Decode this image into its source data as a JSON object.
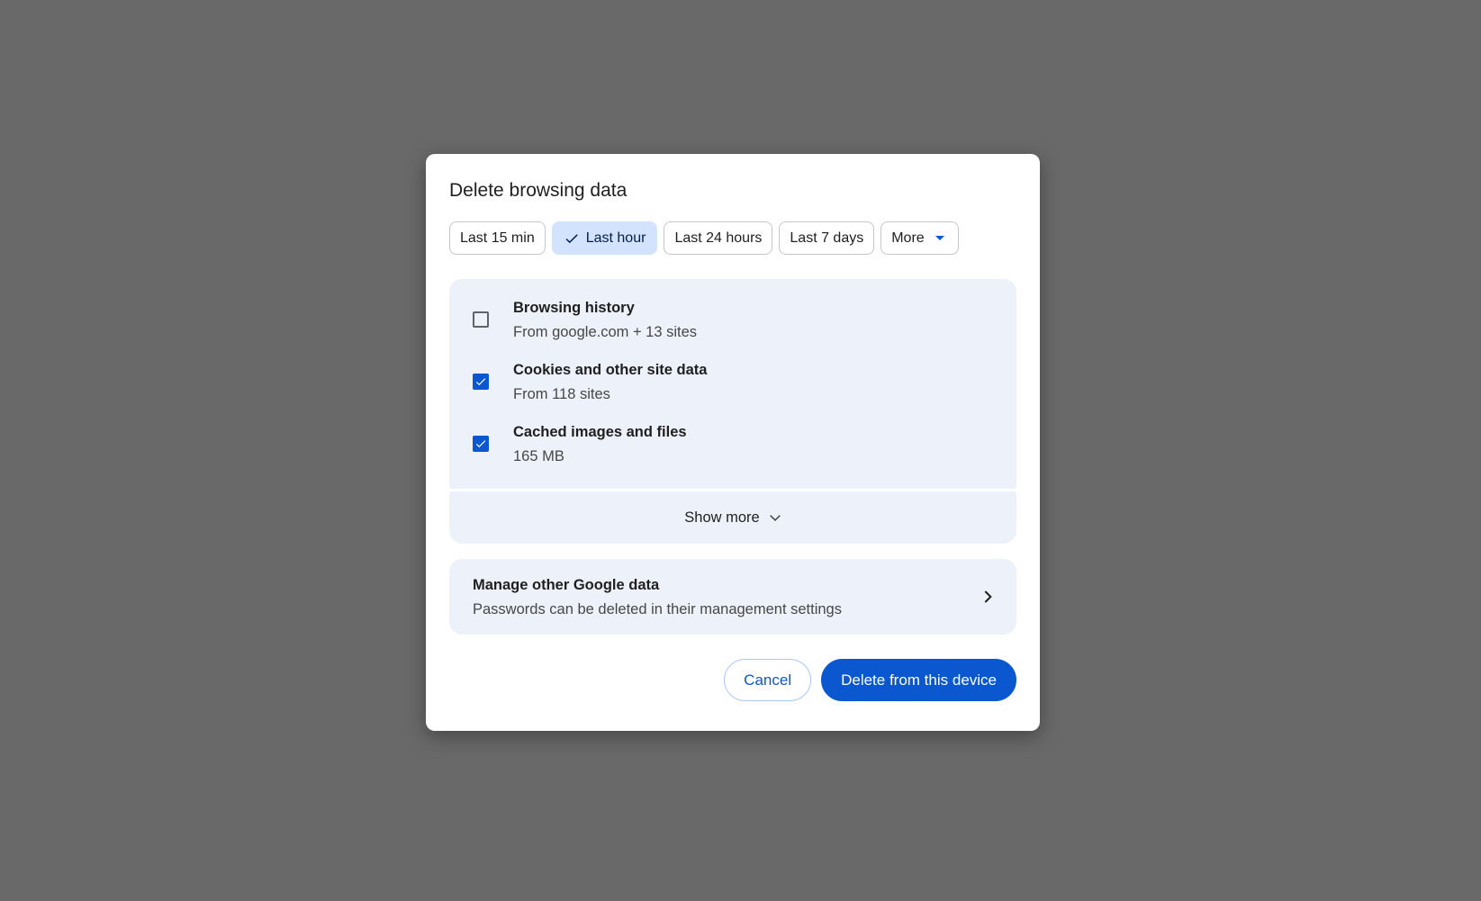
{
  "dialog": {
    "title": "Delete browsing data"
  },
  "time_ranges": [
    {
      "label": "Last 15 min",
      "selected": false
    },
    {
      "label": "Last hour",
      "selected": true
    },
    {
      "label": "Last 24 hours",
      "selected": false
    },
    {
      "label": "Last 7 days",
      "selected": false
    },
    {
      "label": "More",
      "selected": false,
      "dropdown": true
    }
  ],
  "options": [
    {
      "title": "Browsing history",
      "subtitle": "From google.com + 13 sites",
      "checked": false
    },
    {
      "title": "Cookies and other site data",
      "subtitle": "From 118 sites",
      "checked": true
    },
    {
      "title": "Cached images and files",
      "subtitle": "165 MB",
      "checked": true
    }
  ],
  "show_more": {
    "label": "Show more",
    "icon": "chevron-down-icon"
  },
  "manage": {
    "title": "Manage other Google data",
    "subtitle": "Passwords can be deleted in their management settings",
    "icon": "chevron-right-icon"
  },
  "buttons": {
    "cancel": "Cancel",
    "delete": "Delete from this device"
  },
  "colors": {
    "backdrop": "#696969",
    "accent": "#0b57d0",
    "selected_chip": "#d3e3fd",
    "panel": "#edf2fa"
  }
}
